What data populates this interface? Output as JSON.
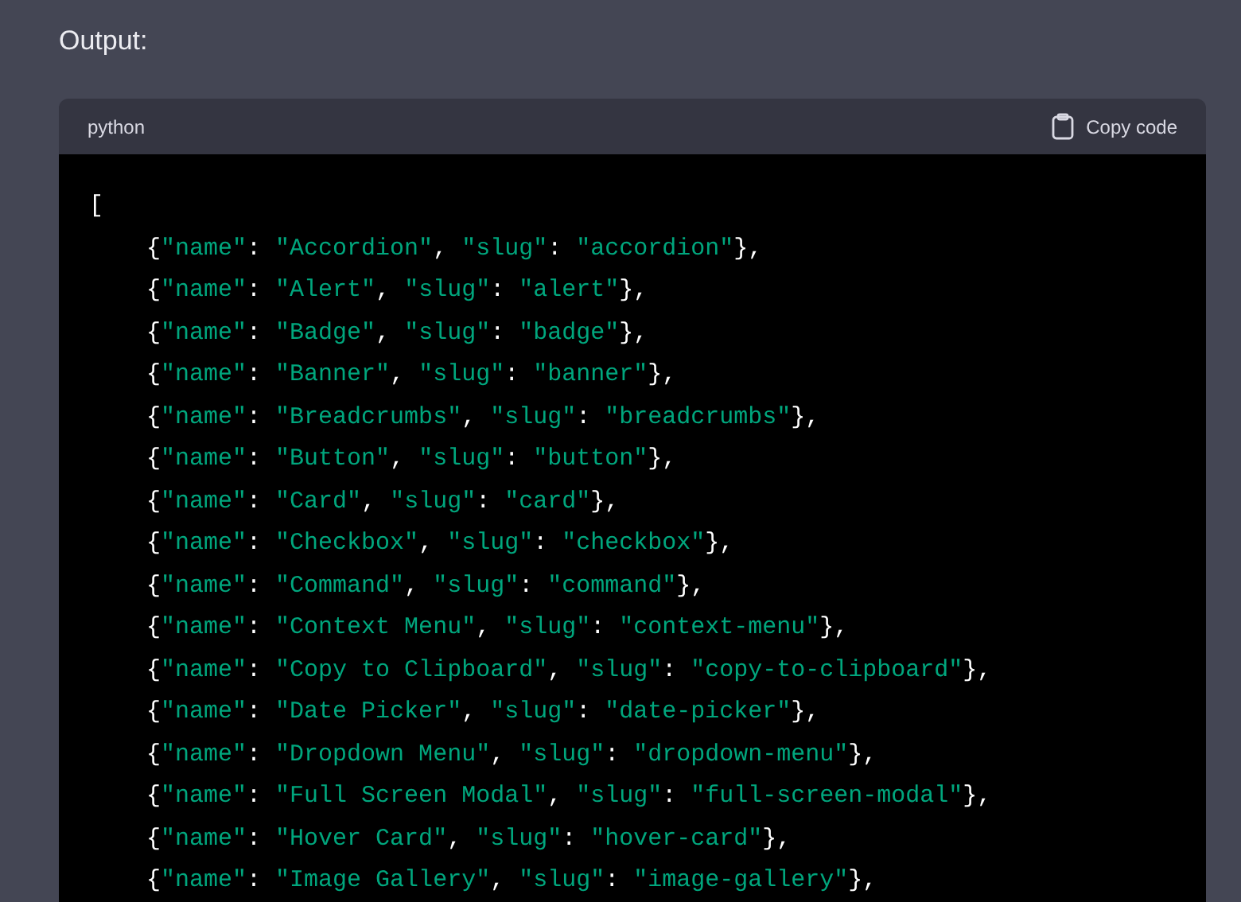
{
  "heading": "Output:",
  "code_block": {
    "language": "python",
    "copy_button": "Copy code",
    "lines": [
      "[",
      "    {\"name\": \"Accordion\", \"slug\": \"accordion\"},",
      "    {\"name\": \"Alert\", \"slug\": \"alert\"},",
      "    {\"name\": \"Badge\", \"slug\": \"badge\"},",
      "    {\"name\": \"Banner\", \"slug\": \"banner\"},",
      "    {\"name\": \"Breadcrumbs\", \"slug\": \"breadcrumbs\"},",
      "    {\"name\": \"Button\", \"slug\": \"button\"},",
      "    {\"name\": \"Card\", \"slug\": \"card\"},",
      "    {\"name\": \"Checkbox\", \"slug\": \"checkbox\"},",
      "    {\"name\": \"Command\", \"slug\": \"command\"},",
      "    {\"name\": \"Context Menu\", \"slug\": \"context-menu\"},",
      "    {\"name\": \"Copy to Clipboard\", \"slug\": \"copy-to-clipboard\"},",
      "    {\"name\": \"Date Picker\", \"slug\": \"date-picker\"},",
      "    {\"name\": \"Dropdown Menu\", \"slug\": \"dropdown-menu\"},",
      "    {\"name\": \"Full Screen Modal\", \"slug\": \"full-screen-modal\"},",
      "    {\"name\": \"Hover Card\", \"slug\": \"hover-card\"},",
      "    {\"name\": \"Image Gallery\", \"slug\": \"image-gallery\"},"
    ]
  }
}
